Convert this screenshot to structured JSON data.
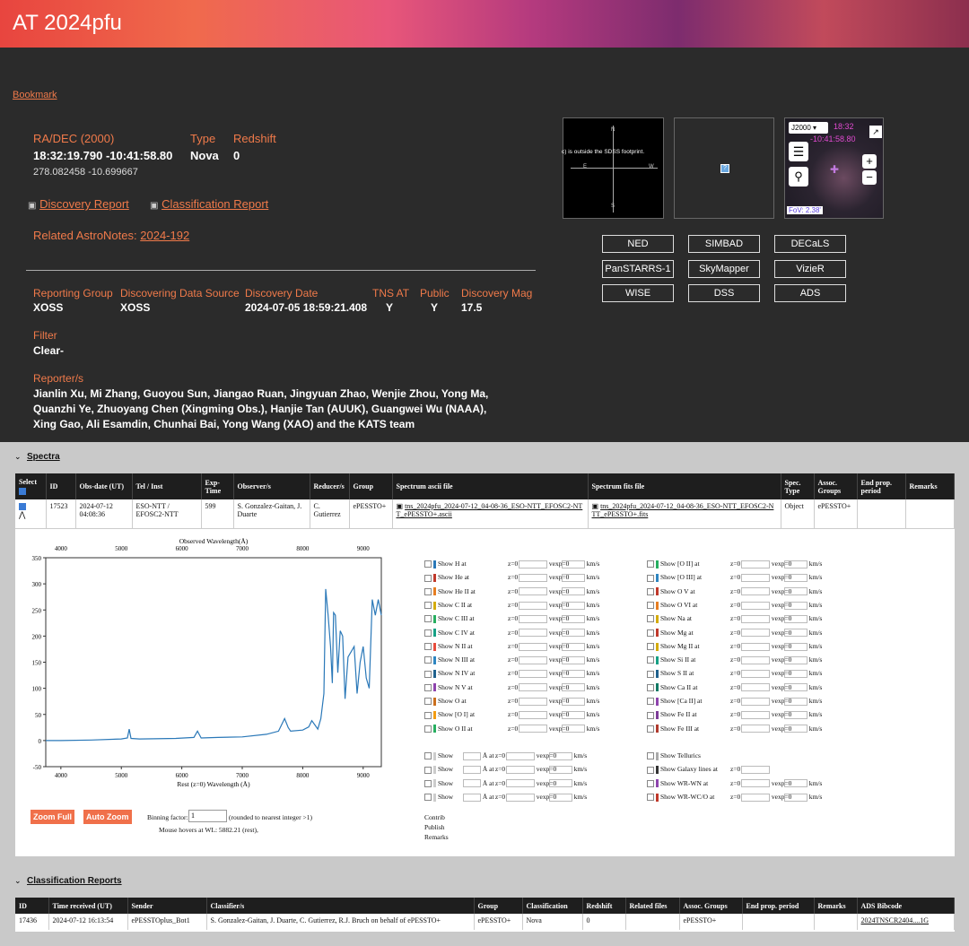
{
  "page": {
    "title": "AT 2024pfu",
    "bookmark": "Bookmark"
  },
  "coords": {
    "radec_label": "RA/DEC (2000)",
    "type_label": "Type",
    "redshift_label": "Redshift",
    "radec": "18:32:19.790 -10:41:58.80",
    "type": "Nova",
    "redshift": "0",
    "deg": "278.082458 -10.699667"
  },
  "reports": {
    "discovery": "Discovery Report",
    "classification": "Classification Report",
    "astronotes_label": "Related AstroNotes:",
    "astronote": "2024-192"
  },
  "discovery": {
    "headers": [
      "Reporting Group",
      "Discovering Data Source",
      "Discovery Date",
      "TNS AT",
      "Public",
      "Discovery Mag"
    ],
    "values": [
      "XOSS",
      "XOSS",
      "2024-07-05 18:59:21.408",
      "Y",
      "Y",
      "17.5"
    ],
    "filter_label": "Filter",
    "filter": "Clear-",
    "reporters_label": "Reporter/s",
    "reporters": "Jianlin Xu, Mi Zhang, Guoyou Sun, Jiangao Ruan, Jingyuan Zhao, Wenjie Zhou, Yong Ma, Quanzhi Ye, Zhuoyang Chen (Xingming Obs.), Hanjie Tan (AUUK), Guangwei Wu (NAAA), Xing Gao, Ali Esamdin, Chunhai Bai, Yong Wang (XAO) and the KATS team"
  },
  "thumbs": {
    "sdss": "c) is outside the SDSS footprint.",
    "compass": [
      "N",
      "E",
      "W",
      "S"
    ],
    "aladin_frame": "J2000",
    "aladin_coord1": "18:32",
    "aladin_coord2": "-10:41:58.80",
    "fov": "FoV: 2.38'"
  },
  "ext_links": [
    "NED",
    "SIMBAD",
    "DECaLS",
    "PanSTARRS-1",
    "SkyMapper",
    "VizieR",
    "WISE",
    "DSS",
    "ADS"
  ],
  "spectra": {
    "section": "Spectra",
    "headers": [
      "Select",
      "ID",
      "Obs-date (UT)",
      "Tel / Inst",
      "Exp-Time",
      "Observer/s",
      "Reducer/s",
      "Group",
      "Spectrum ascii file",
      "Spectrum fits file",
      "Spec. Type",
      "Assoc. Groups",
      "End prop. period",
      "Remarks"
    ],
    "row": {
      "id": "17523",
      "date": "2024-07-12 04:08:36",
      "tel": "ESO-NTT / EFOSC2-NTT",
      "exp": "599",
      "observer": "S. Gonzalez-Gaitan, J. Duarte",
      "reducer": "C. Gutierrez",
      "group": "ePESSTO+",
      "ascii": "tns_2024pfu_2024-07-12_04-08-36_ESO-NTT_EFOSC2-NTT_ePESSTO+.ascii",
      "fits": "tns_2024pfu_2024-07-12_04-08-36_ESO-NTT_EFOSC2-NTT_ePESSTO+.fits",
      "spectype": "Object",
      "assoc": "ePESSTO+"
    }
  },
  "chart_data": {
    "type": "line",
    "title": "",
    "xlabel_top": "Observed Wavelength(Å)",
    "xlabel": "Rest (z=0) Wavelength (Å)",
    "ylim": [
      -50,
      350
    ],
    "xlim": [
      3750,
      9300
    ],
    "yticks": [
      350,
      300,
      250,
      200,
      150,
      100,
      50,
      0,
      -50
    ],
    "xticks_top": [
      4000,
      5000,
      6000,
      7000,
      8000,
      9000
    ],
    "xticks": [
      4000,
      5000,
      6000,
      7000,
      8000,
      9000
    ],
    "x": [
      3750,
      4000,
      4500,
      5000,
      5100,
      5130,
      5160,
      5300,
      5900,
      6200,
      6260,
      6320,
      6600,
      7000,
      7400,
      7600,
      7700,
      7760,
      7800,
      8000,
      8100,
      8150,
      8200,
      8250,
      8300,
      8350,
      8380,
      8420,
      8460,
      8490,
      8510,
      8540,
      8580,
      8620,
      8660,
      8700,
      8750,
      8800,
      8850,
      8900,
      8950,
      9000,
      9050,
      9100,
      9150,
      9200,
      9250,
      9300
    ],
    "y": [
      0,
      0,
      1,
      3,
      5,
      22,
      4,
      3,
      4,
      6,
      18,
      5,
      6,
      7,
      12,
      18,
      42,
      25,
      18,
      20,
      26,
      38,
      30,
      22,
      42,
      90,
      290,
      240,
      180,
      110,
      245,
      240,
      130,
      210,
      200,
      80,
      160,
      170,
      180,
      90,
      150,
      180,
      120,
      100,
      270,
      240,
      270,
      240
    ]
  },
  "lines": {
    "left": [
      "Show H at",
      "Show He at",
      "Show He II at",
      "Show C II at",
      "Show C III at",
      "Show C IV at",
      "Show N II at",
      "Show N III at",
      "Show N IV at",
      "Show N V at",
      "Show O at",
      "Show [O I] at",
      "Show O II at"
    ],
    "right": [
      "Show [O II] at",
      "Show [O III] at",
      "Show O V at",
      "Show O VI at",
      "Show Na at",
      "Show Mg at",
      "Show Mg II at",
      "Show Si II at",
      "Show S II at",
      "Show Ca II at",
      "Show [Ca II] at",
      "Show Fe II at",
      "Show Fe III at"
    ],
    "z": "z=0",
    "v": "vexp=0",
    "unit": "km/s",
    "show": "Show",
    "ang": "Å at",
    "tellurics": "Show Tellurics",
    "galaxy": "Show Galaxy lines at",
    "wrwn": "Show WR-WN at",
    "wrwc": "Show WR-WC/O at"
  },
  "controls": {
    "zoom_full": "Zoom Full",
    "auto_zoom": "Auto Zoom",
    "binning_label": "Binning factor:",
    "binning": "1",
    "binning_note": "(rounded to nearest integer >1)",
    "hover": "Mouse hovers at WL: 5882.21 (rest),",
    "contrib": "Contrib",
    "publish": "Publish",
    "remarks": "Remarks"
  },
  "classif": {
    "section": "Classification Reports",
    "headers": [
      "ID",
      "Time received (UT)",
      "Sender",
      "Classifier/s",
      "Group",
      "Classification",
      "Redshift",
      "Related files",
      "Assoc. Groups",
      "End prop. period",
      "Remarks",
      "ADS Bibcode"
    ],
    "row": [
      "17436",
      "2024-07-12 16:13:54",
      "ePESSTOplus_Bot1",
      "S. Gonzalez-Gaitan, J. Duarte, C. Gutierrez, R.J. Bruch on behalf of ePESSTO+",
      "ePESSTO+",
      "Nova",
      "0",
      "",
      "ePESSTO+",
      "",
      "",
      "2024TNSCR2404....1G"
    ]
  },
  "colors": {
    "accent": "#f07a4a",
    "line": "#2a78b8"
  }
}
